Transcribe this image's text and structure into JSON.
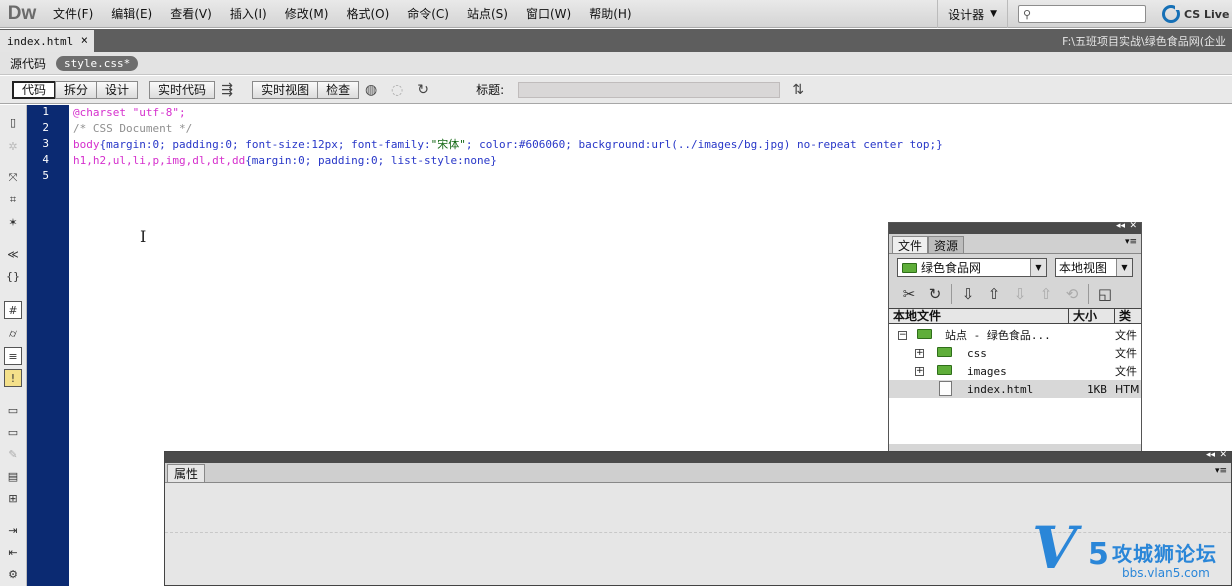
{
  "app": {
    "logo": "Dw",
    "menu": [
      "文件(F)",
      "编辑(E)",
      "查看(V)",
      "插入(I)",
      "修改(M)",
      "格式(O)",
      "命令(C)",
      "站点(S)",
      "窗口(W)",
      "帮助(H)"
    ],
    "workspace": "设计器",
    "search_placeholder": "",
    "cslive": "CS Live"
  },
  "doc_tabs": {
    "active_tab": "index.html",
    "close": "×",
    "path": "F:\\五班项目实战\\绿色食品网(企业"
  },
  "related": {
    "source": "源代码",
    "css_file": "style.css*"
  },
  "doc_toolbar": {
    "view_code": "代码",
    "view_split": "拆分",
    "view_design": "设计",
    "live_code": "实时代码",
    "live_view": "实时视图",
    "inspect": "检查",
    "title_label": "标题:",
    "title_value": ""
  },
  "code": {
    "line_numbers": [
      "1",
      "2",
      "3",
      "4",
      "5"
    ],
    "line1": "@charset \"utf-8\";",
    "line2": "/* CSS Document */",
    "line3": {
      "sel": "body",
      "p1": "{margin:0; padding:0; font-size:12px; font-family:",
      "str": "\"宋体\"",
      "p2": "; color:#606060; background:url(../images/bg.jpg) no-repeat center top;}"
    },
    "line4": {
      "sel": "h1,h2,ul,li,p,img,dl,dt,dd",
      "p1": "{margin:0; padding:0; list-style:none}"
    }
  },
  "files_panel": {
    "tab_files": "文件",
    "tab_assets": "资源",
    "site": "绿色食品网",
    "view": "本地视图",
    "col_name": "本地文件",
    "col_size": "大小",
    "col_type": "类型",
    "rows": [
      {
        "name": "站点 - 绿色食品...",
        "size": "",
        "type": "文件"
      },
      {
        "name": "css",
        "size": "",
        "type": "文件"
      },
      {
        "name": "images",
        "size": "",
        "type": "文件"
      },
      {
        "name": "index.html",
        "size": "1KB",
        "type": "HTM"
      }
    ]
  },
  "properties_panel": {
    "tab": "属性"
  },
  "watermark": {
    "v": "V",
    "five": "5",
    "name": "攻城狮论坛",
    "url": "bbs.vlan5.com"
  },
  "colors": {
    "gutter": "#0b2a72",
    "selector": "#d52fcd",
    "comment": "#8f8f8f",
    "property": "#2837c8",
    "watermark": "#2a86d8"
  }
}
